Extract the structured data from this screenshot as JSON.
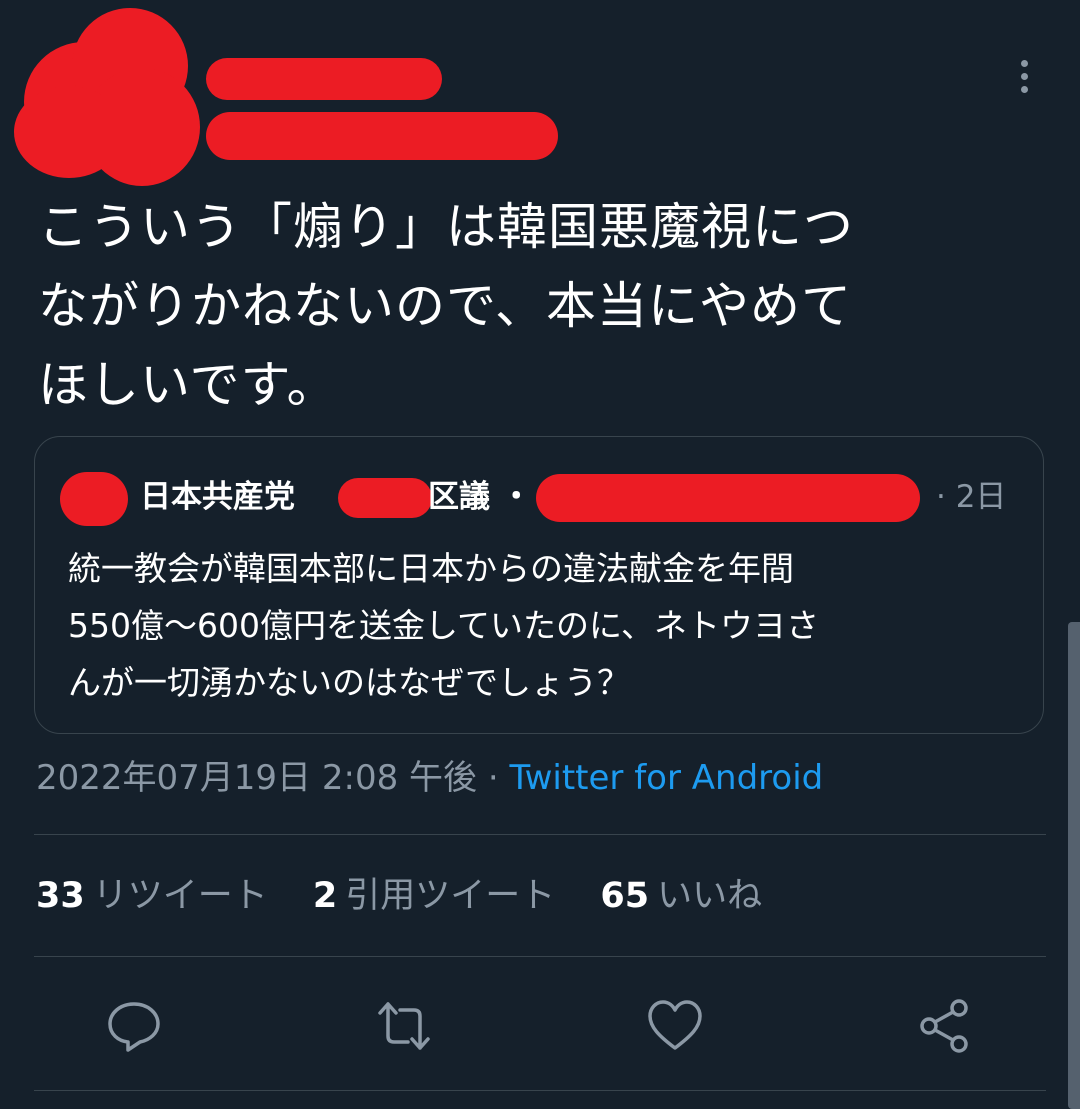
{
  "tweet": {
    "lines": [
      "こういう「煽り」は韓国悪魔視につ",
      "ながりかねないので、本当にやめて",
      "ほしいです。"
    ]
  },
  "quote": {
    "name_prefix": "日本共産党",
    "name_suffix": "区議 ・",
    "time": "· 2日",
    "lines": [
      "統一教会が韓国本部に日本からの違法献金を年間",
      "550億〜600億円を送金していたのに、ネトウヨさ",
      "んが一切湧かないのはなぜでしょう？"
    ]
  },
  "meta": {
    "timestamp": "2022年07月19日 2:08 午後 · ",
    "source": "Twitter for Android"
  },
  "stats": {
    "retweets_count": "33",
    "retweets_label": "リツイート",
    "quotes_count": "2",
    "quotes_label": "引用ツイート",
    "likes_count": "65",
    "likes_label": "いいね"
  },
  "colors": {
    "background": "#15202b",
    "text": "#ffffff",
    "secondary": "#8b98a5",
    "link": "#1d9bf0",
    "border": "#38444d",
    "redaction": "#ec1c24"
  },
  "icons": [
    "more-vertical-icon",
    "reply-icon",
    "retweet-icon",
    "like-icon",
    "share-icon"
  ]
}
